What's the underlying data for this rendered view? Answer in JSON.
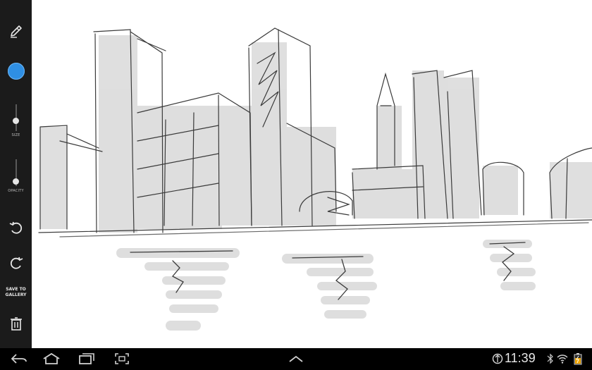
{
  "toolbar": {
    "tools": [
      {
        "name": "pen-icon"
      },
      {
        "name": "color-swatch",
        "color": "#2f8fe3"
      }
    ],
    "size_label": "SIZE",
    "size_value": 0.5,
    "opacity_label": "OPACITY",
    "opacity_value": 0.0,
    "undo_icon": "undo-icon",
    "redo_icon": "redo-icon",
    "save_label_line1": "SAVE TO",
    "save_label_line2": "GALLERY",
    "trash_icon": "trash-icon"
  },
  "canvas": {
    "background": "#ffffff",
    "ink_color": "#3a3a3a",
    "shade_color": "#d6d6d6"
  },
  "navbar": {
    "back_icon": "back-icon",
    "home_icon": "home-icon",
    "recents_icon": "recent-apps-icon",
    "screenshot_icon": "screenshot-icon",
    "up_icon": "chevron-up-icon",
    "time": "11:39",
    "status_icons": [
      "usb-debug-icon",
      "bluetooth-icon",
      "wifi-icon",
      "battery-icon"
    ]
  }
}
